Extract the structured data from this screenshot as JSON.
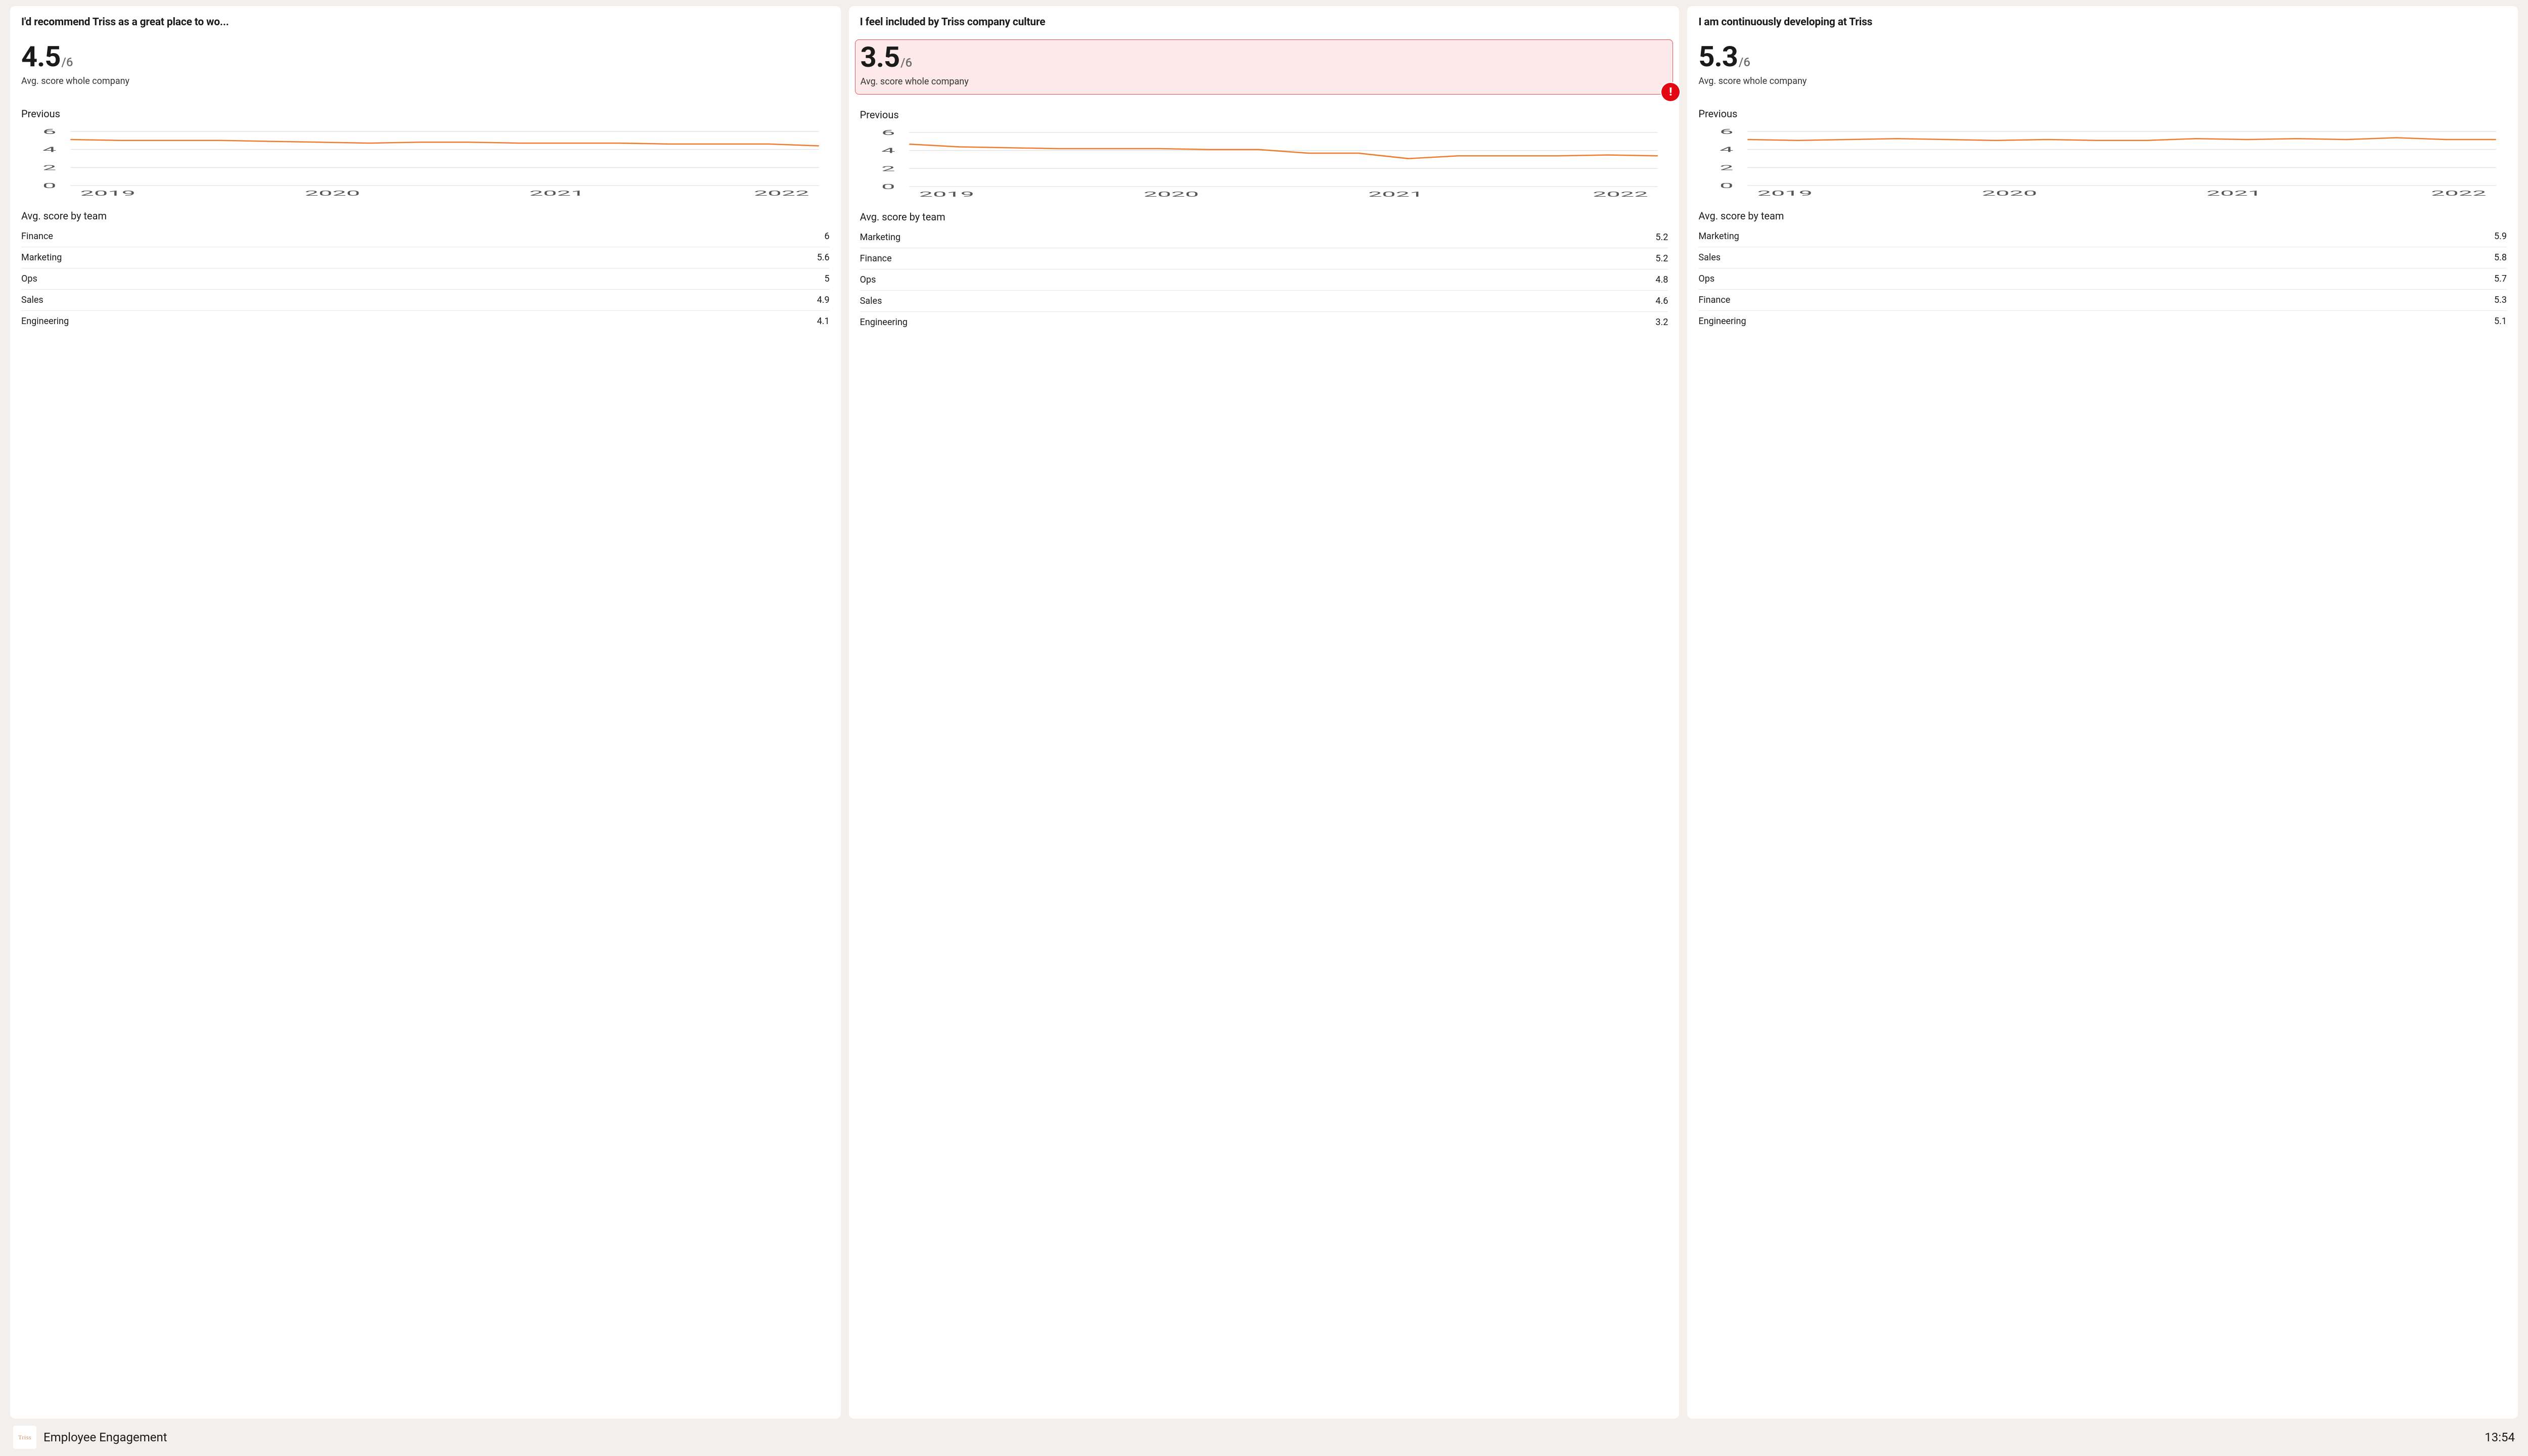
{
  "footer": {
    "logo_text": "Triss",
    "title": "Employee Engagement",
    "time": "13:54"
  },
  "shared": {
    "score_max_suffix": "/6",
    "score_subtitle": "Avg. score whole company",
    "previous_label": "Previous",
    "by_team_label": "Avg. score by team"
  },
  "chart_axes": {
    "y_ticks": [
      0,
      2,
      4,
      6
    ],
    "x_labels": [
      "2019",
      "2020",
      "2021",
      "2022"
    ],
    "ylim": [
      0,
      6.5
    ]
  },
  "cards": [
    {
      "title": "I'd recommend Triss as a great place to wo...",
      "score": "4.5",
      "warn": false,
      "teams": [
        {
          "name": "Finance",
          "value": "6"
        },
        {
          "name": "Marketing",
          "value": "5.6"
        },
        {
          "name": "Ops",
          "value": "5"
        },
        {
          "name": "Sales",
          "value": "4.9"
        },
        {
          "name": "Engineering",
          "value": "4.1"
        }
      ]
    },
    {
      "title": "I feel included by Triss company culture",
      "score": "3.5",
      "warn": true,
      "teams": [
        {
          "name": "Marketing",
          "value": "5.2"
        },
        {
          "name": "Finance",
          "value": "5.2"
        },
        {
          "name": "Ops",
          "value": "4.8"
        },
        {
          "name": "Sales",
          "value": "4.6"
        },
        {
          "name": "Engineering",
          "value": "3.2"
        }
      ]
    },
    {
      "title": "I am continuously developing at Triss",
      "score": "5.3",
      "warn": false,
      "teams": [
        {
          "name": "Marketing",
          "value": "5.9"
        },
        {
          "name": "Sales",
          "value": "5.8"
        },
        {
          "name": "Ops",
          "value": "5.7"
        },
        {
          "name": "Finance",
          "value": "5.3"
        },
        {
          "name": "Engineering",
          "value": "5.1"
        }
      ]
    }
  ],
  "chart_data": [
    {
      "type": "line",
      "title": "Previous — I'd recommend Triss as a great place to work",
      "xlabel": "",
      "ylabel": "",
      "ylim": [
        0,
        6
      ],
      "x_tick_labels": [
        "2019",
        "2020",
        "2021",
        "2022"
      ],
      "x": [
        0,
        1,
        2,
        3,
        4,
        5,
        6,
        7,
        8,
        9,
        10,
        11,
        12,
        13,
        14,
        15
      ],
      "values": [
        5.1,
        5.0,
        5.0,
        5.0,
        4.9,
        4.8,
        4.7,
        4.8,
        4.8,
        4.7,
        4.7,
        4.7,
        4.6,
        4.6,
        4.6,
        4.4
      ]
    },
    {
      "type": "line",
      "title": "Previous — I feel included by Triss company culture",
      "xlabel": "",
      "ylabel": "",
      "ylim": [
        0,
        6
      ],
      "x_tick_labels": [
        "2019",
        "2020",
        "2021",
        "2022"
      ],
      "x": [
        0,
        1,
        2,
        3,
        4,
        5,
        6,
        7,
        8,
        9,
        10,
        11,
        12,
        13,
        14,
        15
      ],
      "values": [
        4.7,
        4.4,
        4.3,
        4.2,
        4.2,
        4.2,
        4.1,
        4.1,
        3.7,
        3.7,
        3.1,
        3.4,
        3.4,
        3.4,
        3.5,
        3.4
      ]
    },
    {
      "type": "line",
      "title": "Previous — I am continuously developing at Triss",
      "xlabel": "",
      "ylabel": "",
      "ylim": [
        0,
        6
      ],
      "x_tick_labels": [
        "2019",
        "2020",
        "2021",
        "2022"
      ],
      "x": [
        0,
        1,
        2,
        3,
        4,
        5,
        6,
        7,
        8,
        9,
        10,
        11,
        12,
        13,
        14,
        15
      ],
      "values": [
        5.1,
        5.0,
        5.1,
        5.2,
        5.1,
        5.0,
        5.1,
        5.0,
        5.0,
        5.2,
        5.1,
        5.2,
        5.1,
        5.3,
        5.1,
        5.1
      ]
    }
  ]
}
